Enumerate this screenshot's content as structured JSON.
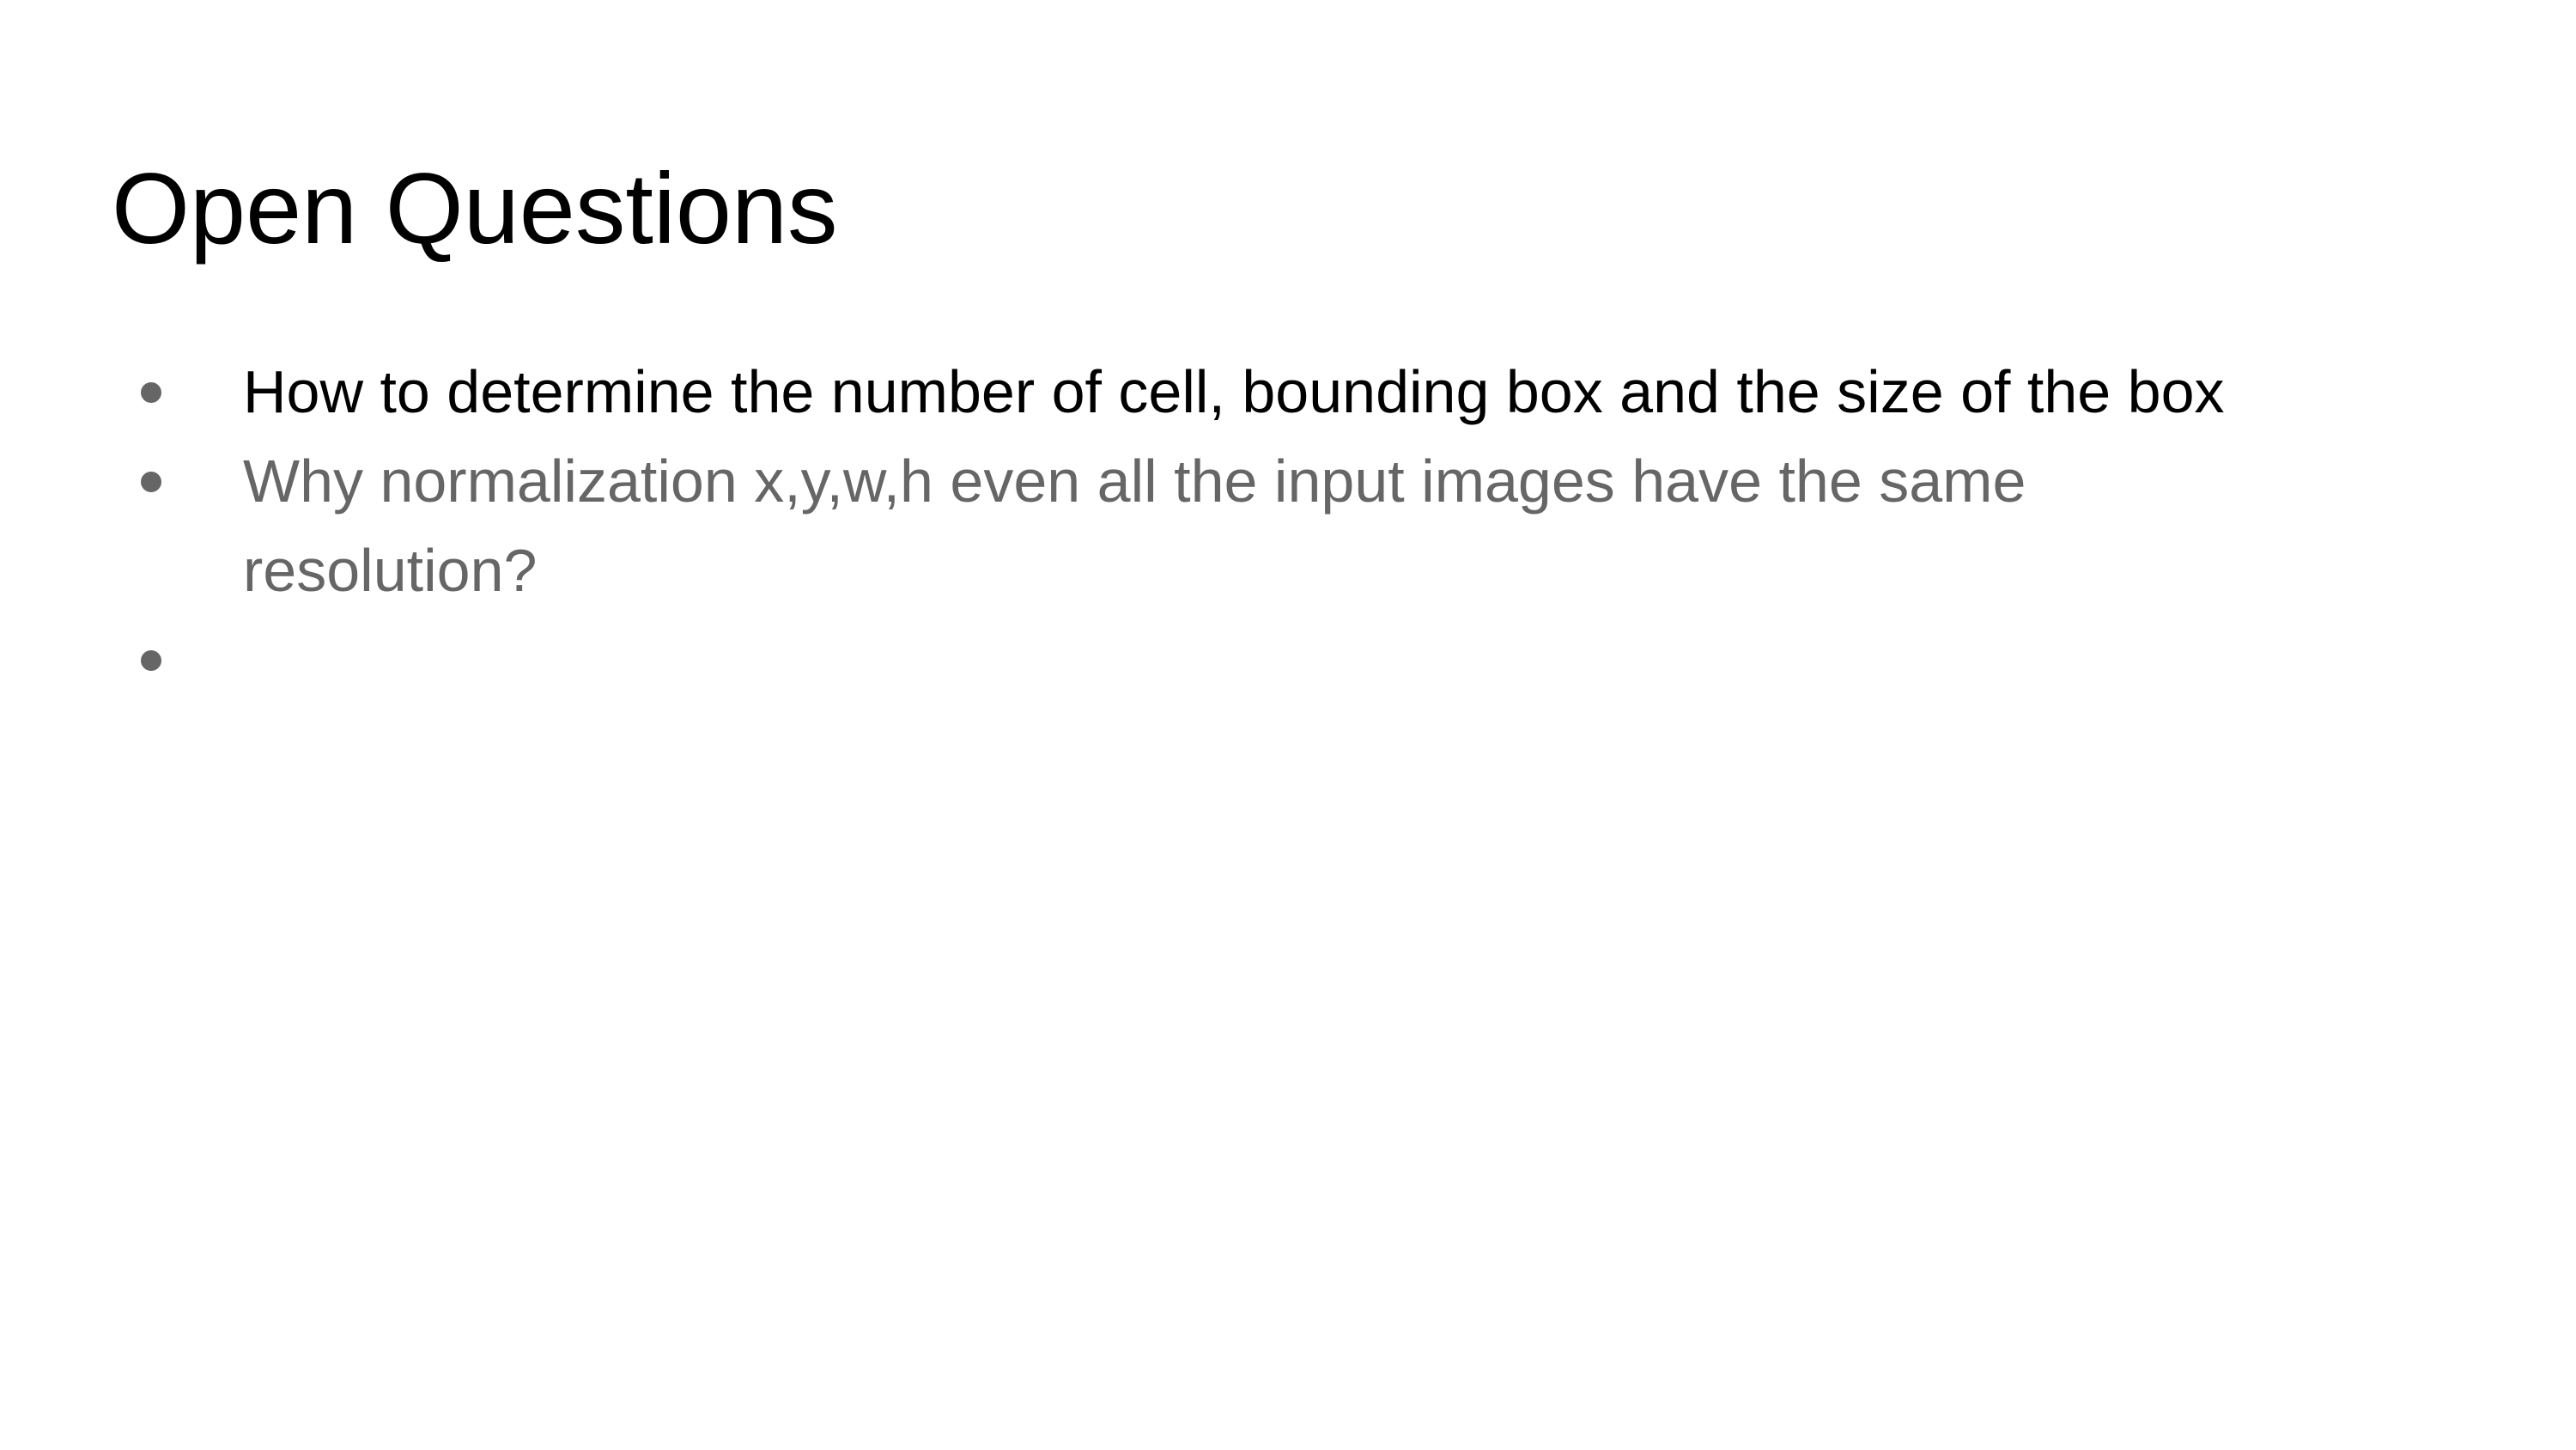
{
  "slide": {
    "title": "Open Questions",
    "bullets": [
      {
        "text": "How to determine the number of cell, bounding box and the size of the box"
      },
      {
        "text": "Why normalization x,y,w,h even all the input images have the same resolution?"
      },
      {
        "text": ""
      }
    ]
  },
  "colors": {
    "title": "#000000",
    "bullet_1": "#000000",
    "bullet_2": "#666666",
    "bullet_marker": "#666666"
  }
}
